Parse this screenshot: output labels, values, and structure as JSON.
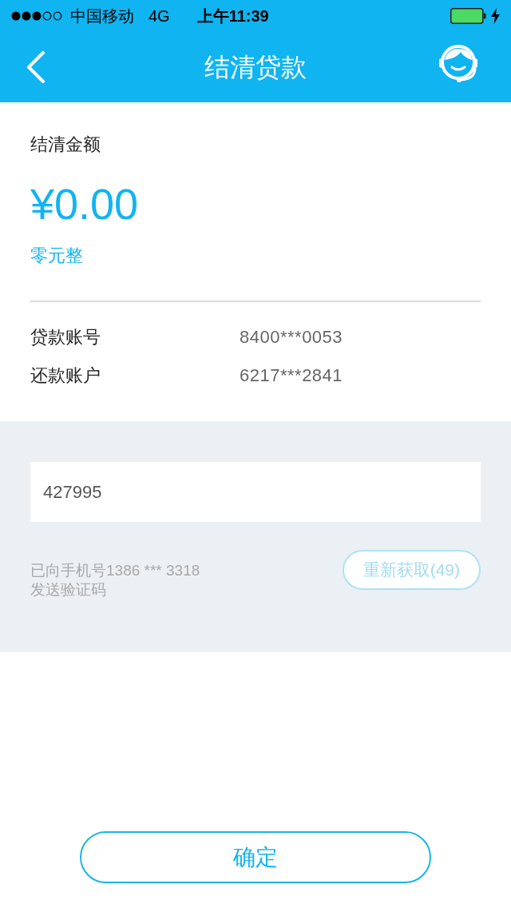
{
  "status_bar": {
    "carrier": "中国移动",
    "network": "4G",
    "time": "上午11:39"
  },
  "nav_bar": {
    "title": "结清贷款"
  },
  "amount": {
    "label": "结清金额",
    "value": "¥0.00",
    "in_words": "零元整"
  },
  "details": [
    {
      "label": "贷款账号",
      "value": "8400***0053"
    },
    {
      "label": "还款账户",
      "value": "6217***2841"
    }
  ],
  "verification": {
    "code_field": {
      "value": "427995"
    },
    "hint": "已向手机号1386 *** 3318\n发送验证码",
    "resend_button": {
      "label": "重新获取(49)",
      "disabled": true
    }
  },
  "confirm_button": {
    "label": "确定"
  }
}
